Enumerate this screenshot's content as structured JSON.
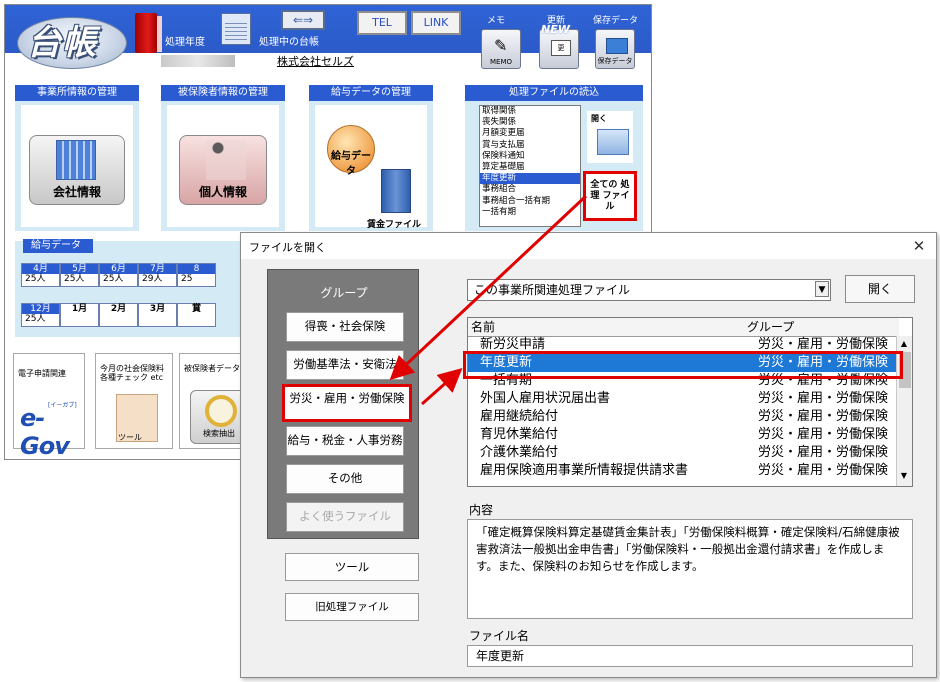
{
  "app": {
    "logo_text": "台帳",
    "fiscal_year_label": "処理年度",
    "current_ledger_label": "処理中の台帳",
    "company_name": "株式会社セルズ",
    "tel_label": "TEL",
    "link_label": "LINK",
    "memo_label": "メモ",
    "memo_btn_label": "MEMO",
    "update_label": "更新",
    "update_badge": "NEW",
    "save_label": "保存データ",
    "save_btn_label": "保存データ",
    "sections": {
      "office_title": "事業所情報の管理",
      "company_info_label": "会社情報",
      "insured_title": "被保険者情報の管理",
      "personal_info_label": "個人情報",
      "pay_title": "給与データの管理",
      "pay_data_label": "給与データ",
      "wage_file_label": "賃金ファイル",
      "file_read_title": "処理ファイルの読込",
      "open_label": "開く",
      "all_files_label": "全ての 処 理 ファイル"
    },
    "file_list": [
      "取得関係",
      "喪失関係",
      "月額変更届",
      "賞与支払届",
      "保険料通知",
      "算定基礎届",
      "年度更新",
      "事務組合",
      "事務組合一括有期",
      "一括有期"
    ],
    "file_list_selected": 6,
    "pay_data": {
      "tab": "給与データ",
      "row1": [
        {
          "m": "4月",
          "v": "25人"
        },
        {
          "m": "5月",
          "v": "25人"
        },
        {
          "m": "6月",
          "v": "25人"
        },
        {
          "m": "7月",
          "v": "29人"
        },
        {
          "m": "8",
          "v": "25"
        }
      ],
      "row2": [
        {
          "m": "12月",
          "v": "25人"
        },
        {
          "m": "1月",
          "v": ""
        },
        {
          "m": "2月",
          "v": ""
        },
        {
          "m": "3月",
          "v": ""
        },
        {
          "m": "賞",
          "v": ""
        }
      ]
    },
    "bottom": {
      "egov_title": "電子申請関連",
      "egov_logo": "e-Gov",
      "egov_sub": "[イーガブ]",
      "check_title": "今月の社会保険料 各種チェック etc",
      "tool_label": "ツール",
      "search_title": "被保険者データ 検索・抽出・チェ",
      "search_btn_label": "検索抽出"
    }
  },
  "dialog": {
    "title": "ファイルを開く",
    "close_glyph": "✕",
    "group_panel_title": "グループ",
    "groups": [
      {
        "label": "得喪・社会保険",
        "state": "normal"
      },
      {
        "label": "労働基準法・安衛法",
        "state": "normal"
      },
      {
        "label": "労災・雇用・労働保険",
        "state": "selected"
      },
      {
        "label": "給与・税金・人事労務",
        "state": "normal"
      },
      {
        "label": "その他",
        "state": "normal"
      },
      {
        "label": "よく使うファイル",
        "state": "disabled"
      }
    ],
    "tools_label": "ツール",
    "old_files_label": "旧処理ファイル",
    "dropdown_value": "この事業所関連処理ファイル",
    "dropdown_arrow": "▼",
    "open_label": "開く",
    "list_headers": {
      "name": "名前",
      "group": "グループ"
    },
    "list_rows": [
      {
        "name": "新労災申請",
        "group": "労災・雇用・労働保険"
      },
      {
        "name": "年度更新",
        "group": "労災・雇用・労働保険"
      },
      {
        "name": "一括有期",
        "group": "労災・雇用・労働保険"
      },
      {
        "name": "外国人雇用状況届出書",
        "group": "労災・雇用・労働保険"
      },
      {
        "name": "雇用継続給付",
        "group": "労災・雇用・労働保険"
      },
      {
        "name": "育児休業給付",
        "group": "労災・雇用・労働保険"
      },
      {
        "name": "介護休業給付",
        "group": "労災・雇用・労働保険"
      },
      {
        "name": "雇用保険適用事業所情報提供請求書",
        "group": "労災・雇用・労働保険"
      }
    ],
    "selected_row": 1,
    "content_label": "内容",
    "content_text": "「確定概算保険料算定基礎賃金集計表」「労働保険料概算・確定保険料/石綿健康被害救済法一般拠出金申告書」「労働保険料・一般拠出金還付請求書」を作成します。また、保険料のお知らせを作成します。",
    "filename_label": "ファイル名",
    "filename_value": "年度更新"
  },
  "colors": {
    "highlight_red": "#e00000",
    "header_blue": "#2a5bd1",
    "selection_blue": "#1e78d6"
  }
}
